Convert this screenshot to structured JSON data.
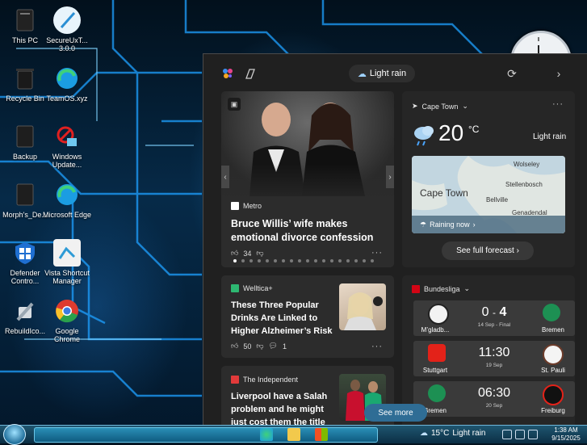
{
  "desktop_icons": [
    {
      "label": "This PC"
    },
    {
      "label": "SecureUxT... 3.0.0"
    },
    {
      "label": "Recycle Bin"
    },
    {
      "label": "TeamOS.xyz"
    },
    {
      "label": "Backup"
    },
    {
      "label": "Windows Update..."
    },
    {
      "label": "Morph's_De..."
    },
    {
      "label": "Microsoft Edge"
    },
    {
      "label": "Defender Contro..."
    },
    {
      "label": "Vista Shortcut Manager"
    },
    {
      "label": "RebuildIco..."
    },
    {
      "label": "Google Chrome"
    }
  ],
  "widgets": {
    "weather_chip": "Light rain",
    "hero": {
      "source": "Metro",
      "headline": "Bruce Willis’ wife makes emotional divorce confession",
      "likes": "34"
    },
    "weather": {
      "location": "Cape Town",
      "temp": "20",
      "unit": "°C",
      "condition": "Light rain",
      "map_city": "Cape Town",
      "map_labels": [
        "Wolseley",
        "Stellenbosch",
        "Bellville",
        "Genadendal"
      ],
      "raining_now": "Raining now",
      "forecast_btn": "See full forecast"
    },
    "article2": {
      "source": "Welltica+",
      "headline": "These Three Popular Drinks Are Linked to Higher Alzheimer’s Risk",
      "likes": "50",
      "comments": "1"
    },
    "article3": {
      "source": "The Independent",
      "headline": "Liverpool have a Salah problem and he might just cost them the title"
    },
    "bundesliga": {
      "title": "Bundesliga",
      "matches": [
        {
          "home": "M’gladb...",
          "away": "Bremen",
          "score_home": "0",
          "sep": "-",
          "score_away": "4",
          "info": "14 Sep - Final"
        },
        {
          "home": "Stuttgart",
          "away": "St. Pauli",
          "time": "11:30",
          "date": "19 Sep"
        },
        {
          "home": "Bremen",
          "away": "Freiburg",
          "time": "06:30",
          "date": "20 Sep"
        }
      ]
    },
    "see_more": "See more"
  },
  "taskbar": {
    "weather_temp": "15°C",
    "weather_text": "Light rain",
    "time": "1:38 AM",
    "date": "9/15/2025"
  },
  "colors": {
    "panel_bg": "#202020",
    "card_bg": "#2c2c2c",
    "accent": "#2f6d95"
  }
}
